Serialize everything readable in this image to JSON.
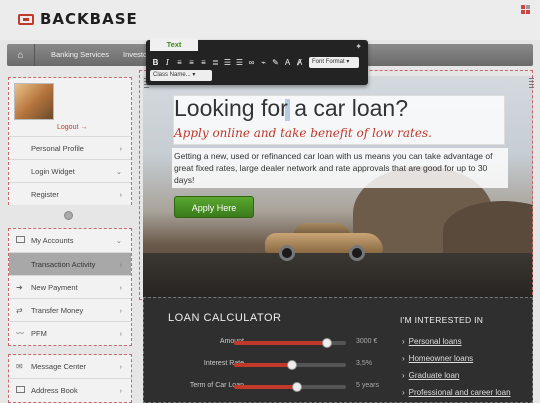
{
  "header": {
    "logo_text": "BACKBASE"
  },
  "nav": {
    "home_icon": "home-icon",
    "items": [
      "Banking Services",
      "Investo"
    ]
  },
  "toolbar": {
    "tab_label": "Text",
    "icons": [
      "bold-icon",
      "italic-icon",
      "align-left-icon",
      "align-center-icon",
      "align-right-icon",
      "align-justify-icon",
      "ordered-list-icon",
      "unordered-list-icon",
      "link-icon",
      "unlink-icon",
      "clean-icon",
      "clear-format-icon",
      "strikethrough-icon"
    ],
    "font_format": "Font Format",
    "class_name": "Class Name..."
  },
  "sidebar": {
    "logout": "Logout →",
    "profile_items": [
      "Personal Profile",
      "Login Widget",
      "Register"
    ],
    "account_items": [
      "My Accounts",
      "Transaction Activity",
      "New Payment",
      "Transfer Money",
      "PFM"
    ],
    "message_items": [
      "Message Center",
      "Address Book"
    ]
  },
  "hero": {
    "title": "Looking for a car loan?",
    "subtitle": "Apply online and take benefit of low rates.",
    "description": "Getting a new, used or refinanced car loan with us means you can take advantage of great fixed rates, large dealer network and rate approvals that are good for up to 30 days!",
    "apply_label": "Apply Here"
  },
  "calculator": {
    "title": "LOAN CALCULATOR",
    "rows": [
      {
        "label": "Amount",
        "value": "3000 €",
        "fill": 0.83
      },
      {
        "label": "Interest Rate",
        "value": "3,5%",
        "fill": 0.52
      },
      {
        "label": "Term of Car Loan",
        "value": "5 years",
        "fill": 0.56
      }
    ]
  },
  "interest": {
    "title": "I'M INTERESTED IN",
    "links": [
      "Personal loans",
      "Homeowner loans",
      "Graduate loan",
      "Professional and career loan"
    ]
  },
  "colors": {
    "accent": "#c0392b",
    "apply": "#4a9a22",
    "panel": "#2f2f2f"
  }
}
